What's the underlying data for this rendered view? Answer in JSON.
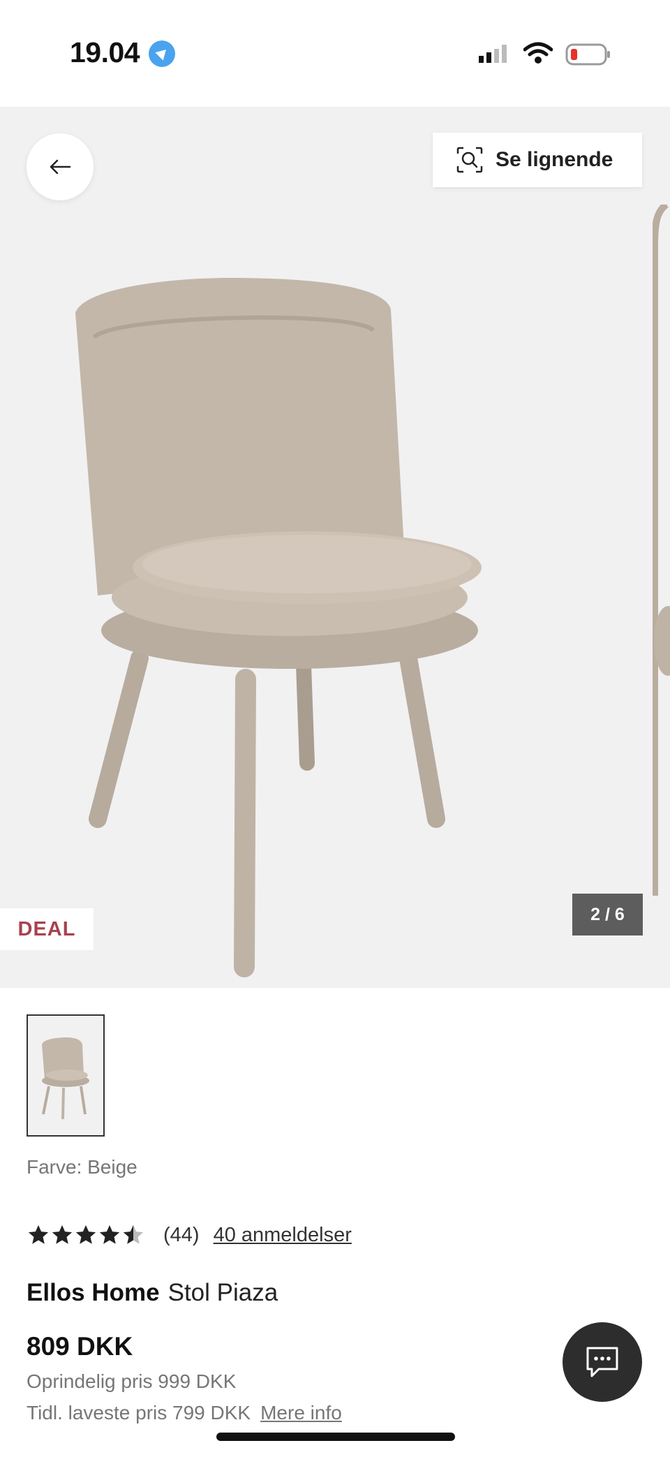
{
  "status_bar": {
    "time": "19.04",
    "icons": [
      "location-icon",
      "cellular-signal-icon",
      "wifi-icon",
      "battery-low-icon"
    ]
  },
  "gallery": {
    "back_icon": "arrow-left-icon",
    "similar_button": {
      "icon": "visual-search-icon",
      "label": "Se lignende"
    },
    "badge": "DEAL",
    "counter": "2 / 6"
  },
  "product": {
    "color_label": "Farve: Beige",
    "rating": {
      "value": 4.5,
      "max": 5,
      "count": "(44)",
      "reviews_link": "40 anmeldelser"
    },
    "brand": "Ellos Home",
    "name": "Stol Piaza",
    "price": "809 DKK",
    "original_price": "Oprindelig pris 999 DKK",
    "lowest_price": "Tidl. laveste pris 799 DKK",
    "more_info": "Mere info"
  },
  "chat": {
    "icon": "chat-bubble-icon"
  },
  "colors": {
    "deal": "#a8424f",
    "gallery_bg": "#f1f1f2",
    "chair": "#bfb3a6",
    "chat_bg": "#2d2d2d",
    "counter_bg": "#5d5d5d"
  }
}
